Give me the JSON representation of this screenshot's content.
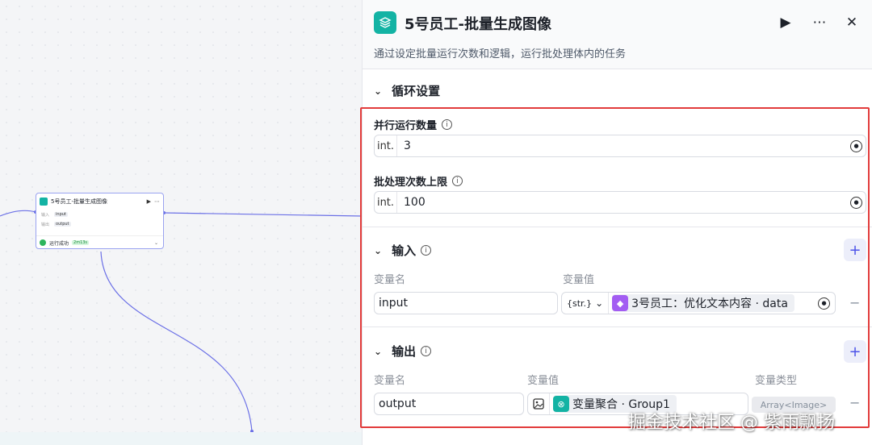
{
  "canvas": {
    "node": {
      "title": "5号员工-批量生成图像",
      "row1_label": "输入",
      "row1_tag": "input",
      "row2_label": "输出",
      "row2_tag": "output",
      "status": "运行成功",
      "time": "2m13s"
    }
  },
  "panel": {
    "title": "5号员工-批量生成图像",
    "description": "通过设定批量运行次数和逻辑，运行批处理体内的任务",
    "loop_section": {
      "title": "循环设置",
      "parallel_label": "并行运行数量",
      "parallel_type": "int.",
      "parallel_value": "3",
      "limit_label": "批处理次数上限",
      "limit_type": "int.",
      "limit_value": "100"
    },
    "input_section": {
      "title": "输入",
      "col_name": "变量名",
      "col_value": "变量值",
      "var_name": "input",
      "var_type": "{str.}",
      "ref_label": "3号员工：优化文本内容 · data"
    },
    "output_section": {
      "title": "输出",
      "col_name": "变量名",
      "col_value": "变量值",
      "col_type": "变量类型",
      "var_name": "output",
      "ref_label": "变量聚合 · Group1",
      "var_type": "Array<Image>"
    }
  },
  "watermark": "掘金技术社区 @ 紫雨飘扬",
  "colors": {
    "accent": "#4d53e8",
    "teal": "#13b3a4",
    "purple": "#a35df2",
    "highlight": "#e23b3b"
  }
}
